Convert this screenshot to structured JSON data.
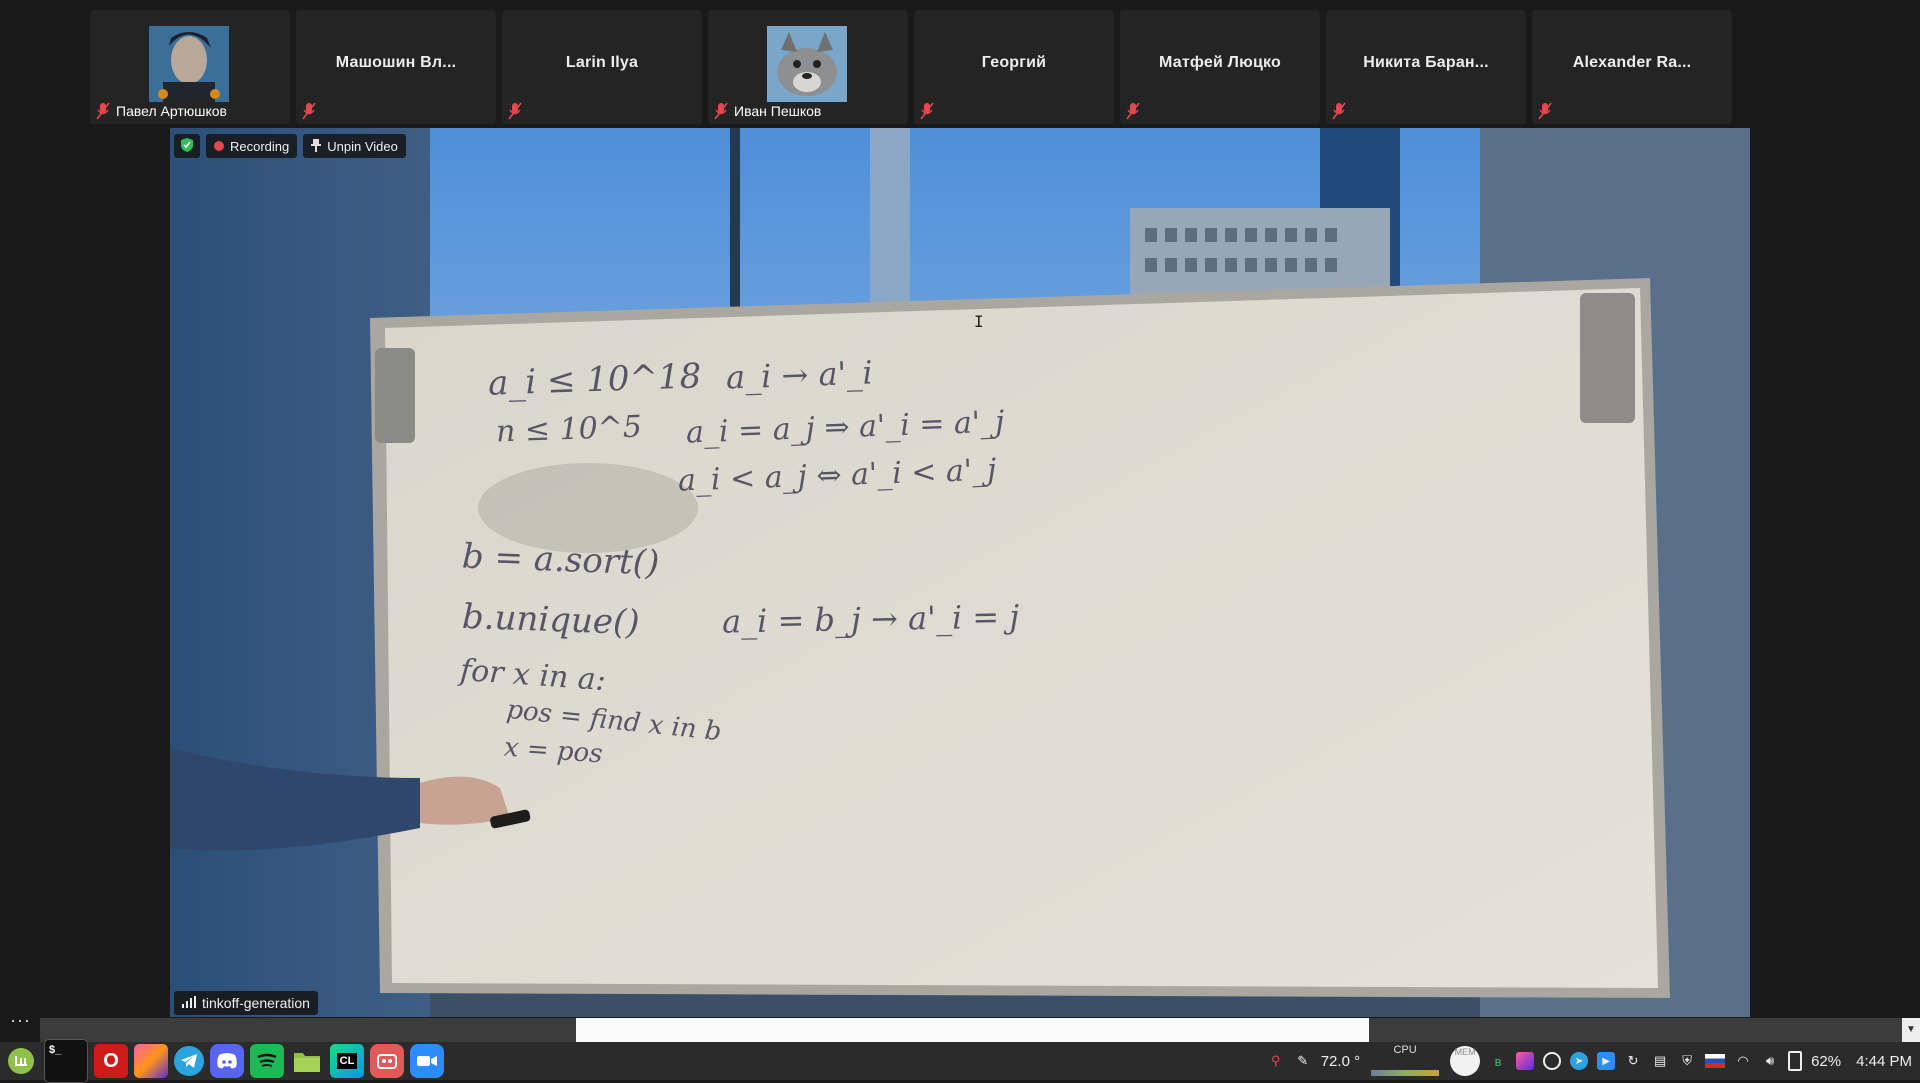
{
  "participants": [
    {
      "name": "Павел Артюшков",
      "has_avatar": true
    },
    {
      "name": "Машошин Вл...",
      "has_avatar": false
    },
    {
      "name": "Larin Ilya",
      "has_avatar": false
    },
    {
      "name": "Иван Пешков",
      "has_avatar": true
    },
    {
      "name": "Георгий",
      "has_avatar": false
    },
    {
      "name": "Матфей Люцко",
      "has_avatar": false
    },
    {
      "name": "Никита Баран...",
      "has_avatar": false
    },
    {
      "name": "Alexander Ra...",
      "has_avatar": false
    }
  ],
  "video": {
    "recording_label": "Recording",
    "unpin_label": "Unpin Video",
    "speaker_name": "tinkoff-generation"
  },
  "whiteboard": {
    "lines": [
      "a_i ≤ 10^18",
      "n ≤ 10^5",
      "a_i → a'_i",
      "a_i = a_j ⇒ a'_i = a'_j",
      "a_i < a_j ⇔ a'_i < a'_j",
      "b = a.sort()",
      "b.unique()",
      "a_i = b_j → a'_i = j",
      "for x in a:",
      "pos = find x in b",
      "x = pos"
    ]
  },
  "taskbar": {
    "apps": [
      "mint-menu",
      "terminal",
      "opera",
      "jetbrains-toolbox",
      "telegram",
      "discord",
      "spotify",
      "files",
      "clion",
      "app-red",
      "zoom"
    ],
    "temperature": "72.0 °",
    "cpu_label": "CPU",
    "mem_label": "MEM",
    "battery": "62%",
    "time": "4:44 PM"
  },
  "colors": {
    "background": "#1a1a1a",
    "tile": "#242424",
    "mic_off": "#e5484d",
    "taskbar": "#2b2b2b"
  }
}
